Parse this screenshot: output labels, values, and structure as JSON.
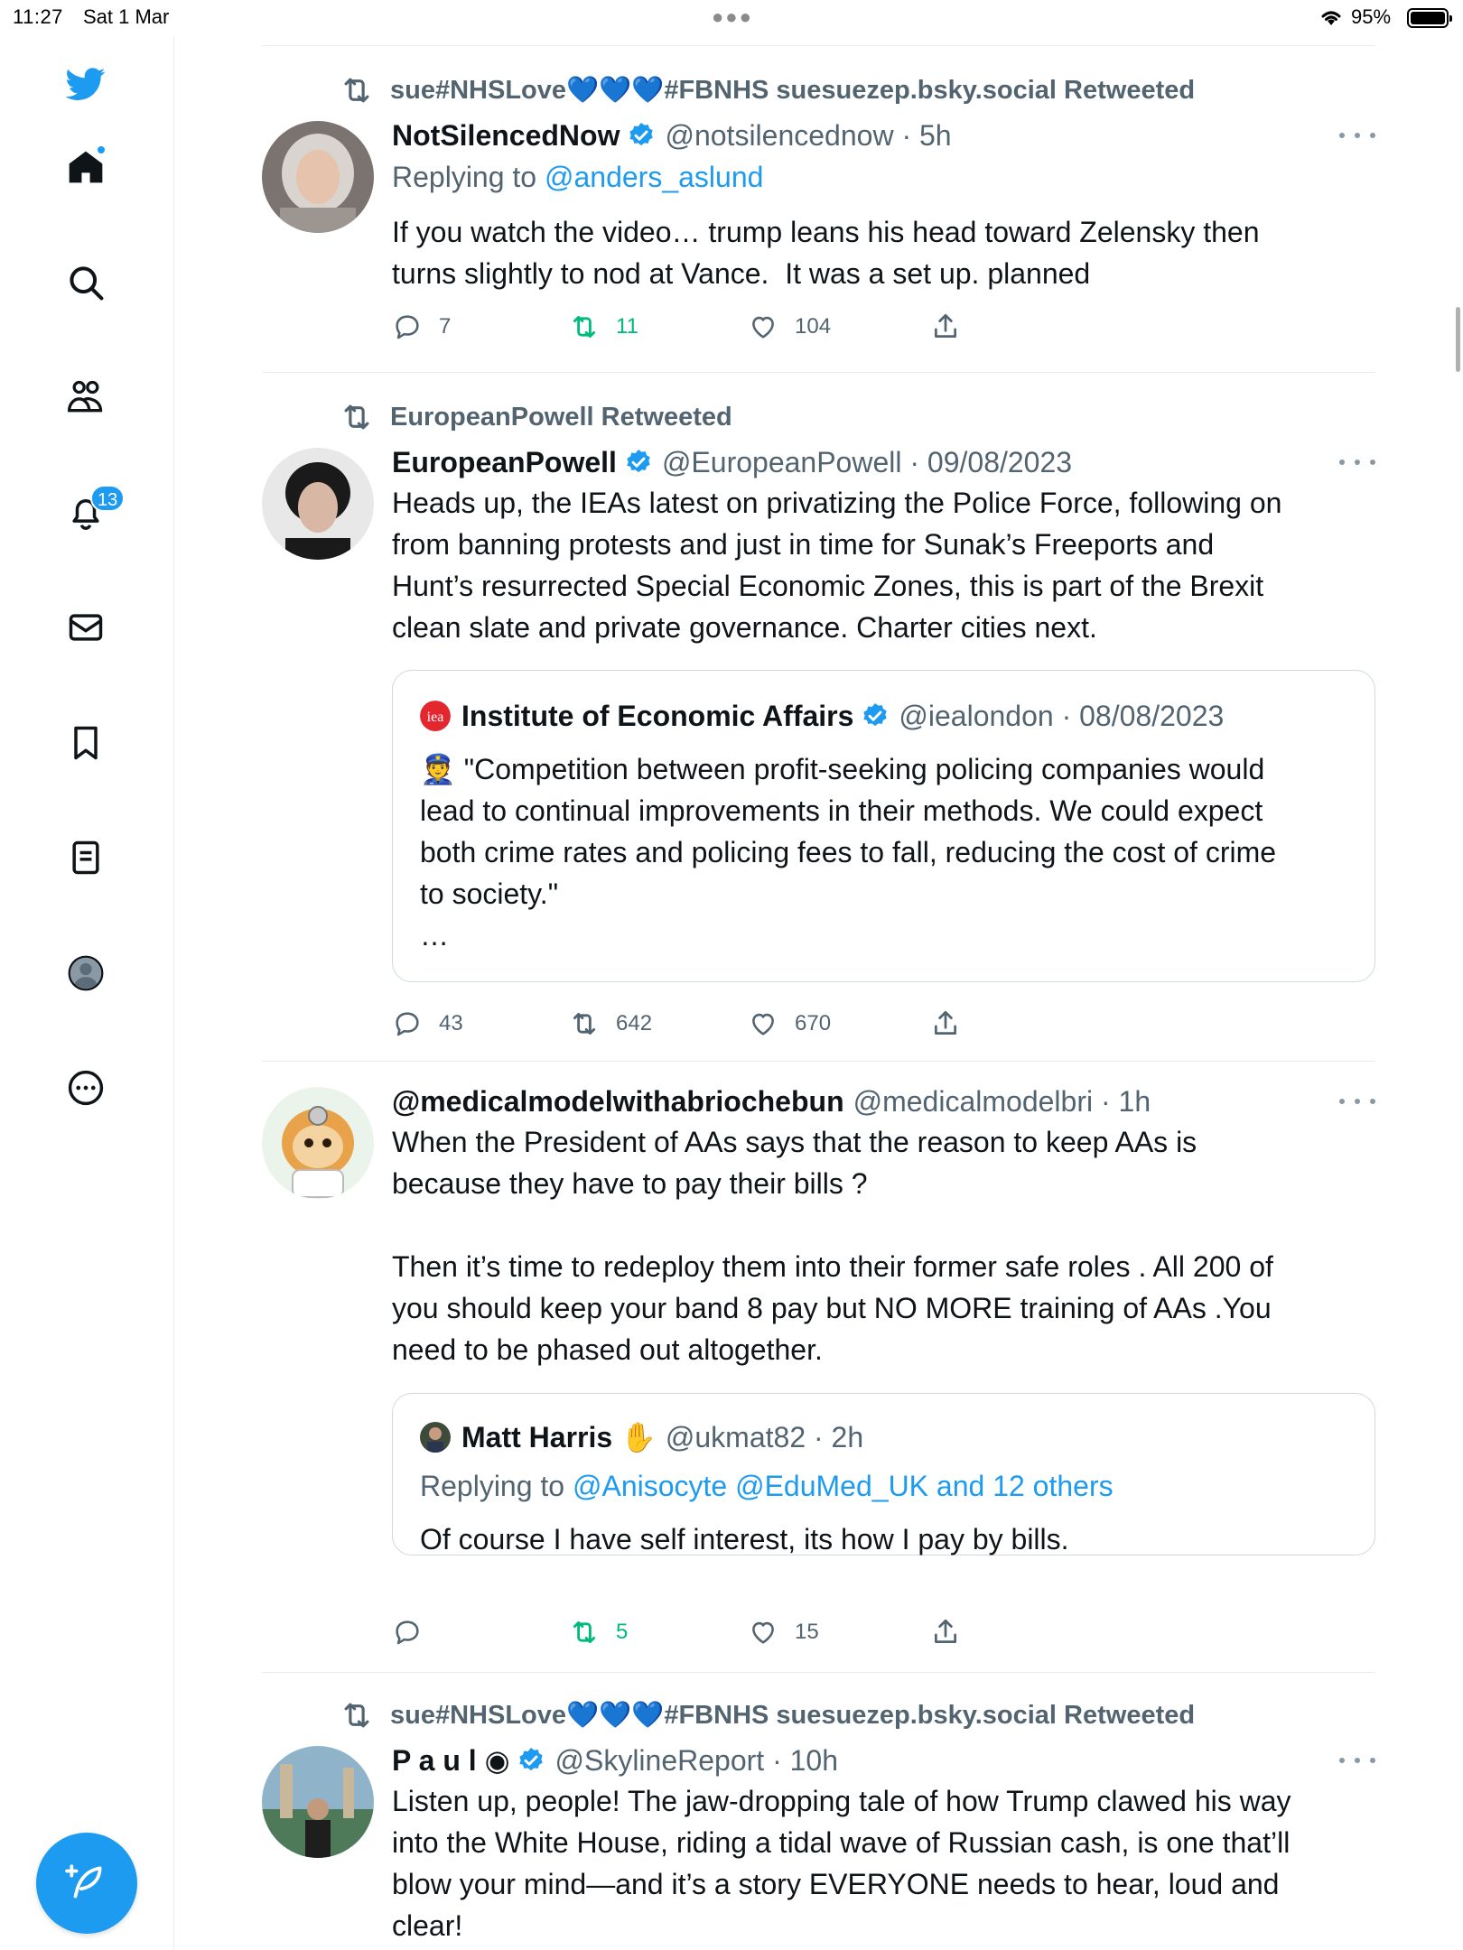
{
  "status_bar": {
    "time": "11:27",
    "date": "Sat 1 Mar",
    "battery_percent": "95%"
  },
  "sidebar": {
    "items": [
      {
        "icon": "twitter-bird-icon"
      },
      {
        "icon": "home-icon",
        "has_dot": true
      },
      {
        "icon": "search-icon"
      },
      {
        "icon": "communities-icon"
      },
      {
        "icon": "notifications-bell-icon",
        "badge": "13"
      },
      {
        "icon": "messages-envelope-icon"
      },
      {
        "icon": "bookmark-icon"
      },
      {
        "icon": "lists-icon"
      },
      {
        "icon": "profile-icon"
      },
      {
        "icon": "more-circle-icon"
      }
    ],
    "compose_icon": "compose-feather-icon"
  },
  "colors": {
    "accent": "#1d9bf0",
    "retweet_green": "#00ba7c",
    "secondary_text": "#536471",
    "border": "#cfd9de"
  },
  "tweets": [
    {
      "retweeted_by": "sue#NHSLove💙💙💙#FBNHS suesuezep.bsky.social Retweeted",
      "name": "NotSilencedNow",
      "handle_time": "@notsilencednow · 5h",
      "reply_prefix": "Replying to ",
      "reply_to": "@anders_aslund",
      "text": "If you watch the video… trump leans his head toward Zelensky then\nturns slightly to nod at Vance.  It was a set up. planned",
      "replies": "7",
      "retweets": "11",
      "likes": "104"
    },
    {
      "retweeted_by": "EuropeanPowell Retweeted",
      "name": "EuropeanPowell",
      "handle_time": "@EuropeanPowell · 09/08/2023",
      "text": "Heads up, the IEAs latest on privatizing the Police Force, following on\nfrom banning protests and just in time for Sunak’s Freeports and\nHunt’s resurrected Special Economic Zones, this is part of the Brexit\nclean slate and private governance. Charter cities next.",
      "quote": {
        "logo_text": "iea",
        "name": "Institute of Economic Affairs",
        "handle_time": "@iealondon · 08/08/2023",
        "text": "👮 \"Competition between profit-seeking policing companies would\nlead to continual improvements in their methods. We could expect\nboth crime rates and policing fees to fall, reducing the cost of crime\nto society.\"\n…"
      },
      "replies": "43",
      "retweets": "642",
      "likes": "670"
    },
    {
      "name": "@medicalmodelwithabriochebun",
      "handle_time": "@medicalmodelbri · 1h",
      "text": "When the President of AAs says that the reason to keep AAs is\nbecause they have to pay their bills ?\n\nThen it’s time to redeploy them into their former safe roles . All 200 of\nyou should keep your band 8 pay but NO MORE training of AAs .You\nneed to be phased out altogether.",
      "quote": {
        "name": "Matt Harris ✋",
        "handle_time": "@ukmat82 · 2h",
        "reply_prefix": "Replying to ",
        "reply_to": "@Anisocyte @EduMed_UK and 12 others",
        "text": "Of course I have self interest, its how I pay by bills."
      },
      "replies": "",
      "retweets": "5",
      "likes": "15"
    },
    {
      "retweeted_by": "sue#NHSLove💙💙💙#FBNHS suesuezep.bsky.social Retweeted",
      "name": "P a u l ◉",
      "handle_time": "@SkylineReport · 10h",
      "text": "Listen up, people! The jaw-dropping tale of how Trump clawed his way\ninto the White House, riding a tidal wave of Russian cash, is one that’ll\nblow your mind—and it’s a story EVERYONE needs to hear, loud and\nclear!"
    }
  ]
}
